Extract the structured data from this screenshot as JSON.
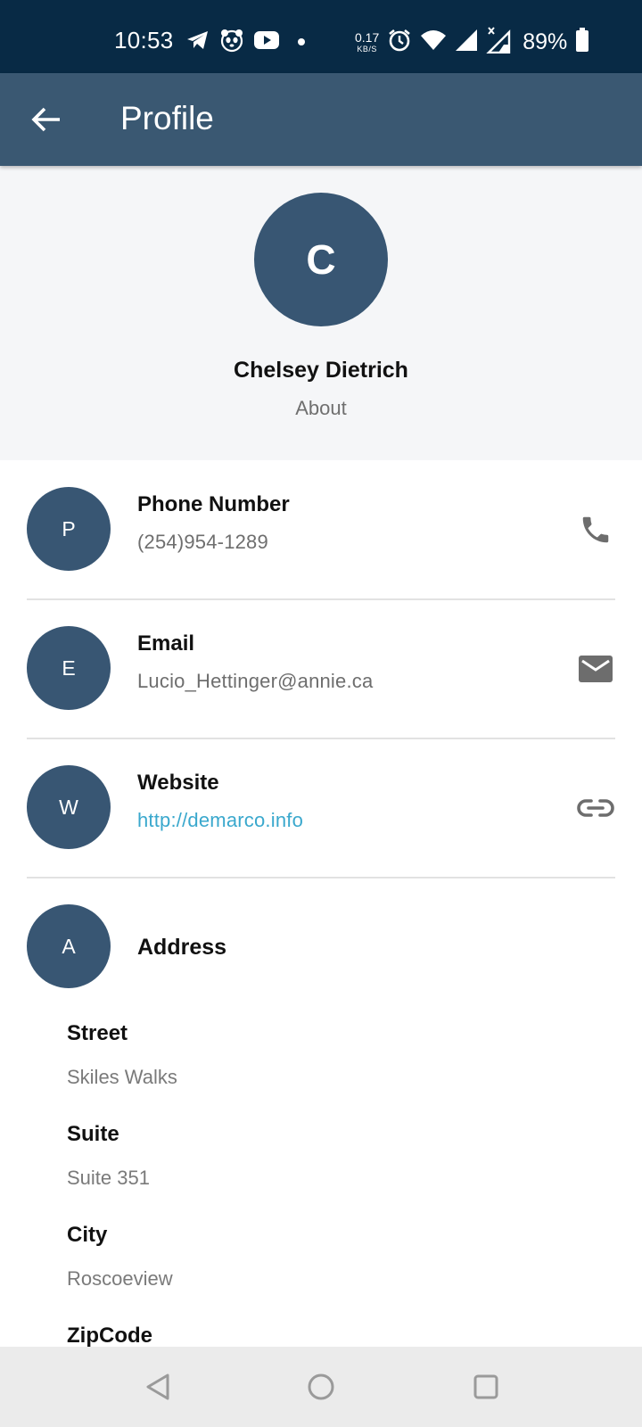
{
  "status_bar": {
    "time": "10:53",
    "net_speed_value": "0.17",
    "net_speed_unit": "KB/S",
    "battery_text": "89%",
    "icons_left": [
      "telegram-icon",
      "panda-icon",
      "youtube-icon"
    ],
    "icons_right": [
      "alarm-icon",
      "wifi-icon",
      "signal-icon",
      "signal-no-data-icon",
      "battery-icon"
    ]
  },
  "app_bar": {
    "title": "Profile",
    "background": "#3a5872"
  },
  "profile": {
    "initial": "C",
    "name": "Chelsey Dietrich",
    "about": "About",
    "avatar_color": "#385673"
  },
  "contact": [
    {
      "initial": "P",
      "label": "Phone Number",
      "value": "(254)954-1289",
      "action_icon": "phone-icon"
    },
    {
      "initial": "E",
      "label": "Email",
      "value": "Lucio_Hettinger@annie.ca",
      "action_icon": "email-icon"
    },
    {
      "initial": "W",
      "label": "Website",
      "value": "http://demarco.info",
      "action_icon": "link-icon"
    }
  ],
  "address": {
    "initial": "A",
    "label": "Address",
    "fields": [
      {
        "label": "Street",
        "value": "Skiles Walks"
      },
      {
        "label": "Suite",
        "value": "Suite 351"
      },
      {
        "label": "City",
        "value": "Roscoeview"
      },
      {
        "label": "ZipCode",
        "value": ""
      }
    ]
  },
  "colors": {
    "link": "#3aa8cd",
    "status_bar": "#082a45"
  }
}
